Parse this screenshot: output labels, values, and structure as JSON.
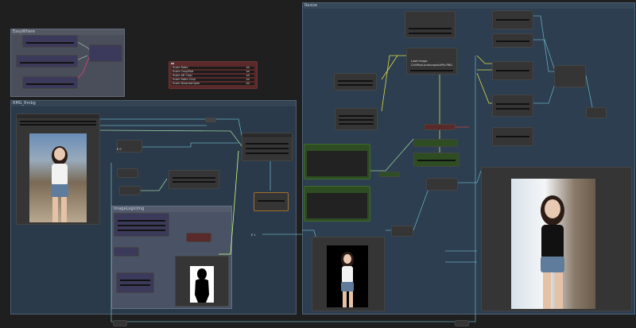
{
  "groups": {
    "easy_where": {
      "title": "EasyWhere"
    },
    "rmbg": {
      "title": "RMG_Rmbg"
    },
    "resize": {
      "title": "Resize"
    },
    "inner": {
      "title": "ImageLogicImg"
    }
  },
  "panel_rows": [
    "Scale Ratio",
    "Scale Crop/Pad",
    "Scale AR Crop",
    "Scale Ratio Crop",
    "Scale Downsampler"
  ],
  "panel_vals": [
    "on",
    "on",
    "on",
    "on",
    "on"
  ],
  "load_node": {
    "title": "Load Image",
    "row1": "ChillFishLandscapeArtPix.PNG",
    "row2": "None"
  },
  "small_labels": {
    "a": "E 0",
    "b": "E 1",
    "c": "Q A",
    "d": "U A"
  },
  "colors": {
    "canvas": "#1f1f1f",
    "group_blue": "#2c3e50",
    "node": "#353535",
    "green_node": "#2e4d22",
    "red_node": "#5a2a2a"
  },
  "icons": {
    "mask_preview": "silhouette-mask",
    "photo": "portrait-photo"
  }
}
